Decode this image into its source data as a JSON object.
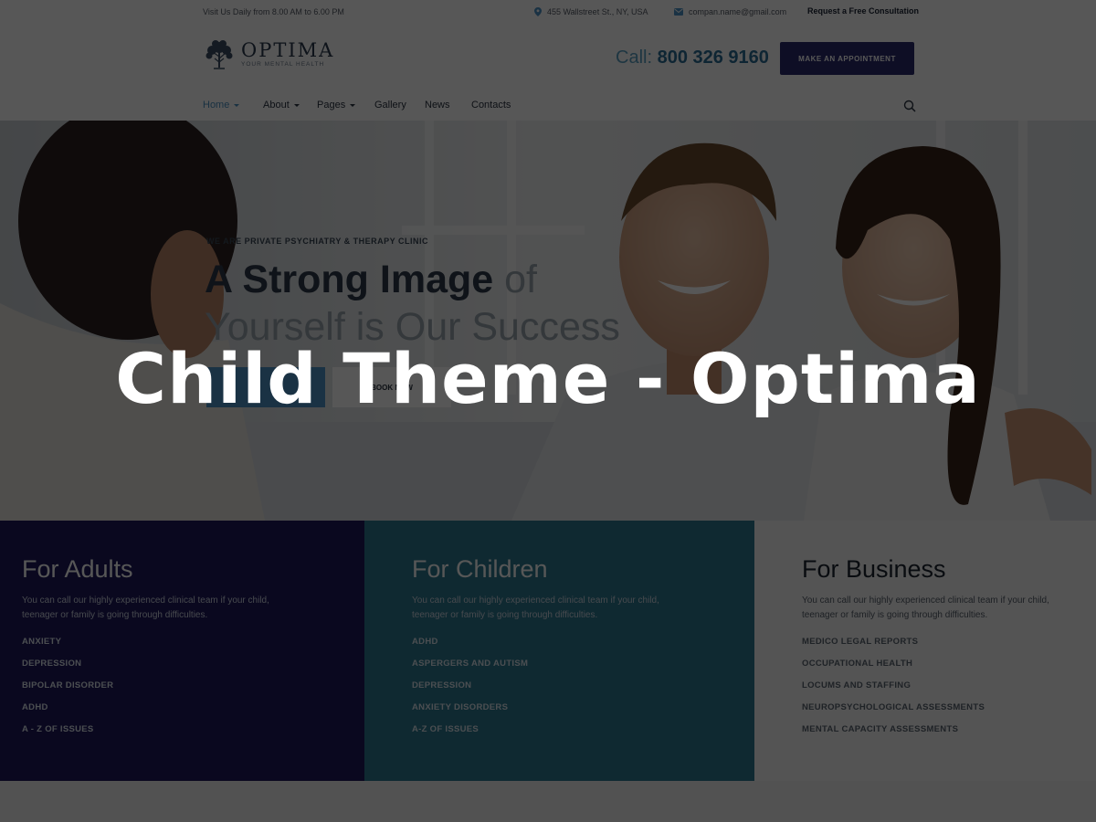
{
  "colors": {
    "accent": "#4d93c6",
    "navy_button": "#2b2b6e",
    "adults_bg": "#1e1a5c",
    "children_bg": "#2c7a8f",
    "business_bg": "#f6f6f6",
    "footer_bg": "#f1f1f1"
  },
  "topbar": {
    "hours": "Visit Us Daily from 8.00 AM to 6.00 PM",
    "address_icon": "map-pin-icon",
    "address": "455 Wallstreet St., NY, USA",
    "email_icon": "envelope-icon",
    "email": "compan.name@gmail.com",
    "consultation": "Request a Free Consultation"
  },
  "header": {
    "logo_icon": "tree-icon",
    "brand_name": "OPTIMA",
    "brand_tagline": "YOUR MENTAL HEALTH",
    "call_label": "Call:",
    "call_number": "800 326 9160",
    "appointment_button": "MAKE AN APPOINTMENT"
  },
  "nav": {
    "items": [
      {
        "label": "Home",
        "dropdown": true,
        "active": true
      },
      {
        "label": "About",
        "dropdown": true,
        "active": false
      },
      {
        "label": "Pages",
        "dropdown": true,
        "active": false
      },
      {
        "label": "Gallery",
        "dropdown": false,
        "active": false
      },
      {
        "label": "News",
        "dropdown": false,
        "active": false
      },
      {
        "label": "Contacts",
        "dropdown": false,
        "active": false
      }
    ],
    "search_icon": "search-icon"
  },
  "hero": {
    "kicker": "WE ARE PRIVATE PSYCHIATRY & THERAPY CLINIC",
    "headline_strong": "A Strong Image",
    "headline_light_1": "of",
    "headline_line2": "Yourself is Our Success",
    "primary_button": "",
    "secondary_button": "BOOK NOW"
  },
  "services": {
    "adults": {
      "title": "For Adults",
      "description": "You can call our highly experienced clinical team if your child, teenager or family is going through difficulties.",
      "items": [
        "ANXIETY",
        "DEPRESSION",
        "BIPOLAR DISORDER",
        "ADHD",
        "A - Z OF ISSUES"
      ]
    },
    "children": {
      "title": "For Children",
      "description": "You can call our highly experienced clinical team if your child, teenager or family is going through difficulties.",
      "items": [
        "ADHD",
        "ASPERGERS AND AUTISM",
        "DEPRESSION",
        "ANXIETY DISORDERS",
        "A-Z OF ISSUES"
      ]
    },
    "business": {
      "title": "For Business",
      "description": "You can call our highly experienced clinical team if your child, teenager or family is going through difficulties.",
      "items": [
        "MEDICO LEGAL REPORTS",
        "OCCUPATIONAL HEALTH",
        "LOCUMS AND STAFFING",
        "NEUROPSYCHOLOGICAL ASSESSMENTS",
        "MENTAL CAPACITY ASSESSMENTS"
      ]
    }
  },
  "watermark": {
    "title": "Child Theme - Optima"
  }
}
